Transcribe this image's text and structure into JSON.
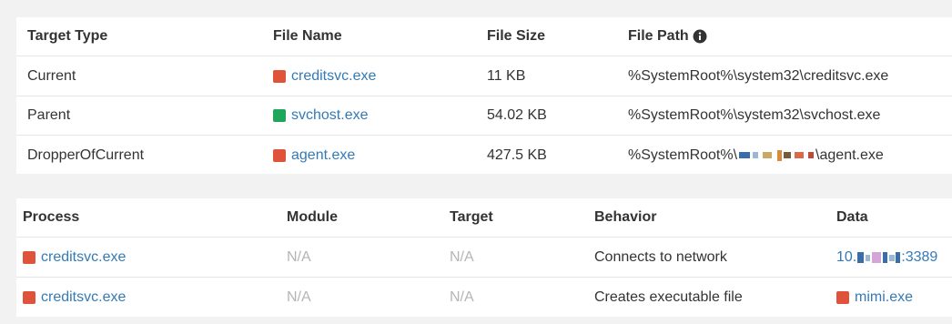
{
  "files_table": {
    "headers": {
      "target_type": "Target Type",
      "file_name": "File Name",
      "file_size": "File Size",
      "file_path": "File Path"
    },
    "rows": [
      {
        "target_type": "Current",
        "file_name": "creditsvc.exe",
        "status": "red",
        "file_size": "11 KB",
        "file_path": "%SystemRoot%\\system32\\creditsvc.exe"
      },
      {
        "target_type": "Parent",
        "file_name": "svchost.exe",
        "status": "green",
        "file_size": "54.02 KB",
        "file_path": "%SystemRoot%\\system32\\svchost.exe"
      },
      {
        "target_type": "DropperOfCurrent",
        "file_name": "agent.exe",
        "status": "red",
        "file_size": "427.5 KB",
        "file_path_prefix": "%SystemRoot%\\",
        "file_path_suffix": "\\agent.exe"
      }
    ]
  },
  "process_table": {
    "headers": {
      "process": "Process",
      "module": "Module",
      "target": "Target",
      "behavior": "Behavior",
      "data": "Data"
    },
    "rows": [
      {
        "process": "creditsvc.exe",
        "status": "red",
        "module": "N/A",
        "target": "N/A",
        "behavior": "Connects to network",
        "data_prefix": "10.",
        "data_suffix": ":3389"
      },
      {
        "process": "creditsvc.exe",
        "status": "red",
        "module": "N/A",
        "target": "N/A",
        "behavior": "Creates executable file",
        "data": "mimi.exe",
        "data_status": "red"
      }
    ]
  },
  "colors": {
    "red_status": "#e0533b",
    "green_status": "#20a65a",
    "link": "#337ab7",
    "na_text": "#b5b5b5"
  }
}
